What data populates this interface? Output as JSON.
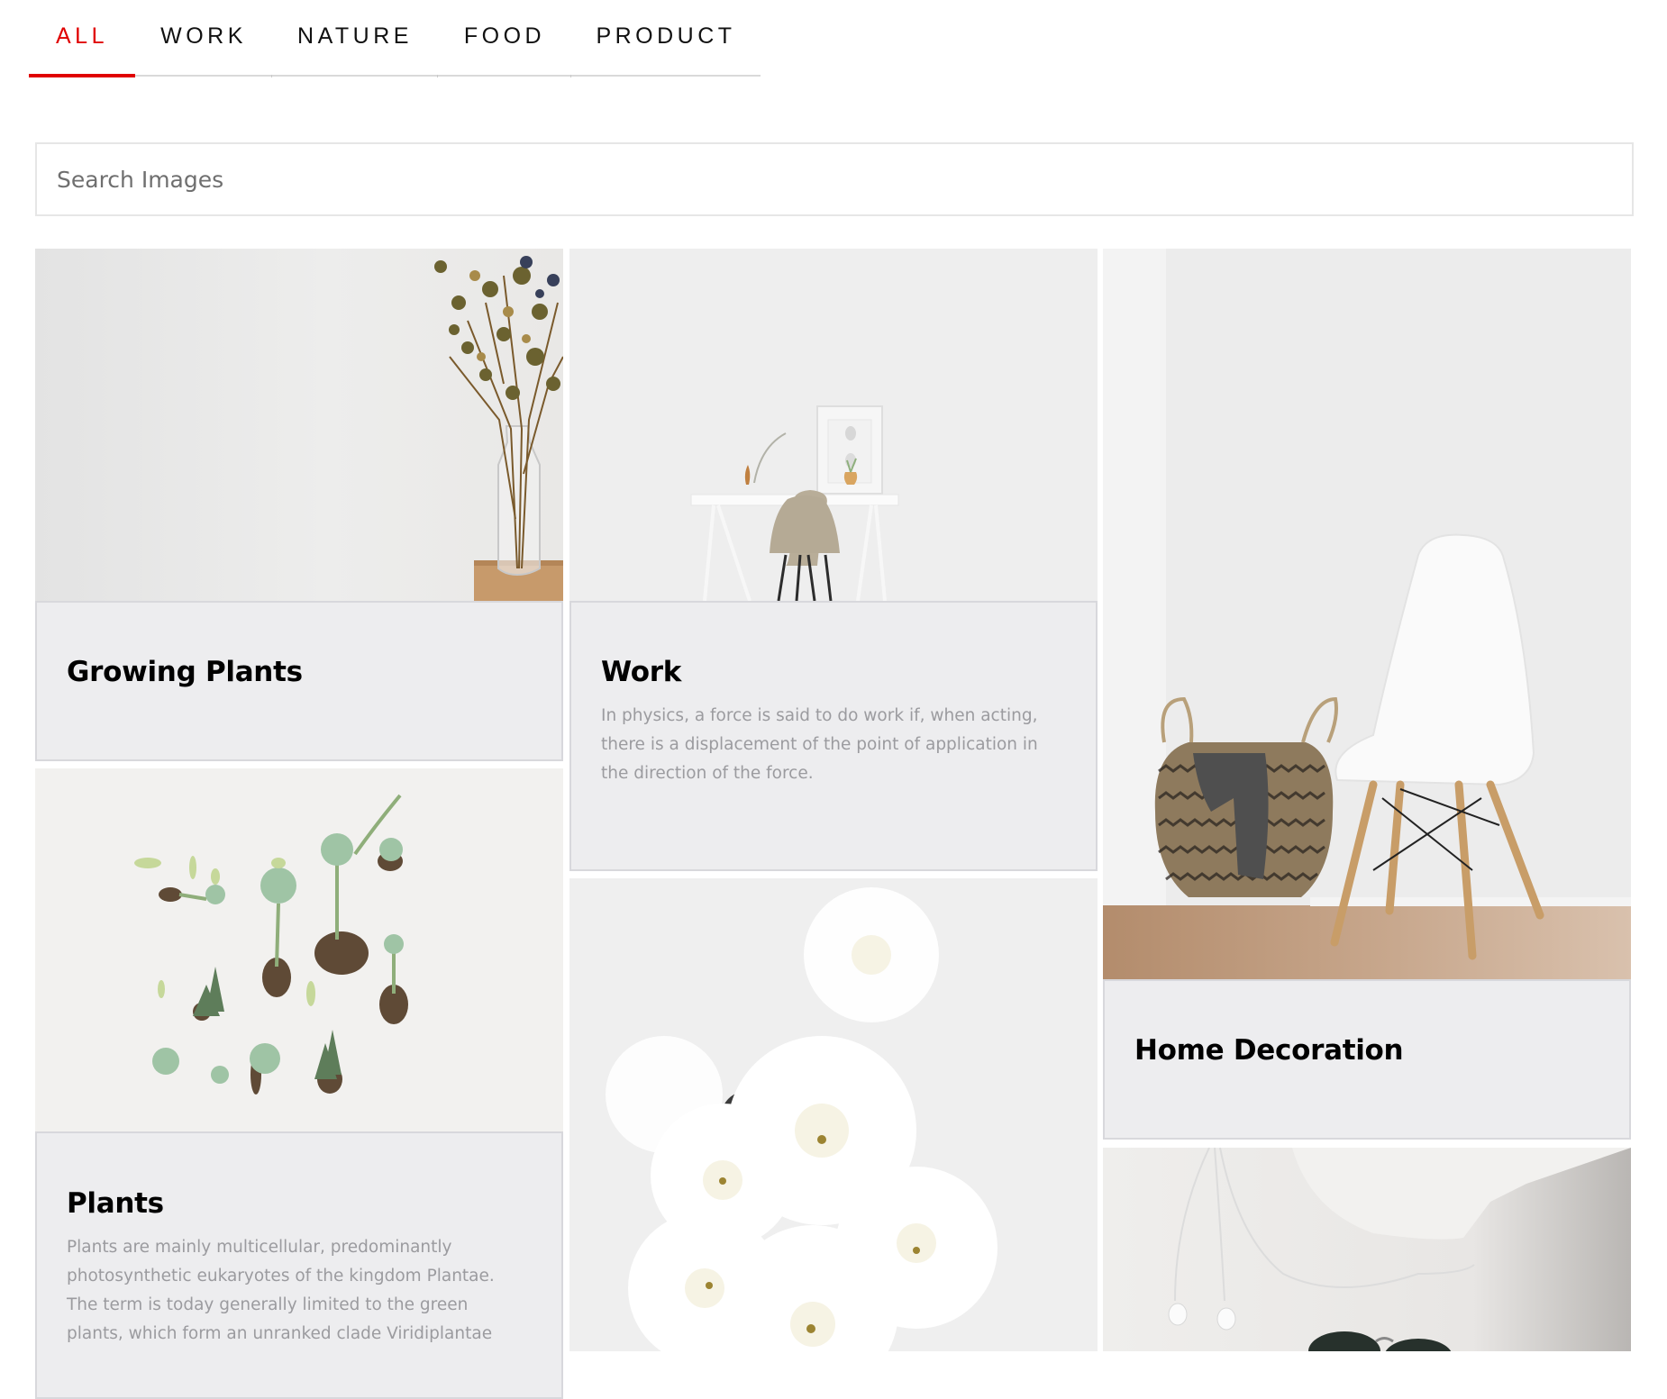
{
  "tabs": [
    {
      "label": "ALL",
      "active": true
    },
    {
      "label": "WORK",
      "active": false
    },
    {
      "label": "NATURE",
      "active": false
    },
    {
      "label": "FOOD",
      "active": false
    },
    {
      "label": "PRODUCT",
      "active": false
    }
  ],
  "accent_color": "#e00000",
  "search": {
    "placeholder": "Search Images",
    "value": ""
  },
  "cards": [
    {
      "id": "growing-plants",
      "title": "Growing Plants",
      "description": "",
      "image": "dried-flowers-in-glass-vase"
    },
    {
      "id": "work",
      "title": "Work",
      "description": "In physics, a force is said to do work if, when acting, there is a displacement of the point of application in the direction of the force.",
      "image": "minimal-desk-with-chair"
    },
    {
      "id": "home-decoration",
      "title": "Home Decoration",
      "description": "",
      "image": "basket-and-white-chair"
    },
    {
      "id": "plants",
      "title": "Plants",
      "description": "Plants are mainly multicellular, predominantly photosynthetic eukaryotes of the kingdom Plantae. The term is today generally limited to the green plants, which form an unranked clade Viridiplantae",
      "image": "succulents-flat-lay"
    },
    {
      "id": "flowers",
      "title": "",
      "description": "",
      "image": "white-chrysanthemums"
    },
    {
      "id": "product",
      "title": "",
      "description": "",
      "image": "earphones-and-sunglasses"
    }
  ]
}
